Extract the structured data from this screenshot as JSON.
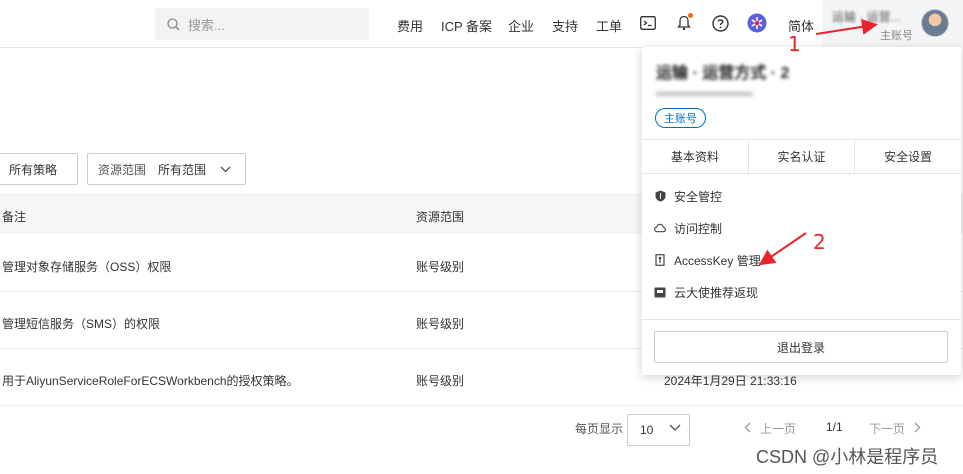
{
  "topbar": {
    "search_placeholder": "搜索...",
    "nav": [
      "费用",
      "ICP 备案",
      "企业",
      "支持",
      "工单"
    ],
    "lang": "简体",
    "account_name": "运输 · 运营...",
    "account_type": "主账号"
  },
  "filters": {
    "policy_type": "所有策略",
    "scope_label": "资源范围",
    "scope_value": "所有范围"
  },
  "table": {
    "headers": [
      "备注",
      "资源范围"
    ],
    "rows": [
      {
        "note": "管理对象存储服务（OSS）权限",
        "scope": "账号级别",
        "extra": ""
      },
      {
        "note": "管理短信服务（SMS）的权限",
        "scope": "账号级别",
        "extra": ""
      },
      {
        "note": "用于AliyunServiceRoleForECSWorkbench的授权策略。",
        "scope": "账号级别",
        "extra": "2024年1月29日 21:33:16"
      }
    ]
  },
  "pagination": {
    "per_page_label": "每页显示",
    "per_page": "10",
    "prev": "上一页",
    "page": "1/1",
    "next": "下一页"
  },
  "account_panel": {
    "name": "运输 · 运营方式 · 2",
    "account_id": "•••••••••••••••••••••••",
    "badge": "主账号",
    "tabs": [
      "基本资料",
      "实名认证",
      "安全设置"
    ],
    "menu": [
      "安全管控",
      "访问控制",
      "AccessKey 管理",
      "云大使推荐返现"
    ],
    "logout": "退出登录"
  },
  "annotations": {
    "marker1": "1",
    "marker2": "2",
    "color": "#e8232a"
  },
  "watermark": "CSDN @小林是程序员"
}
